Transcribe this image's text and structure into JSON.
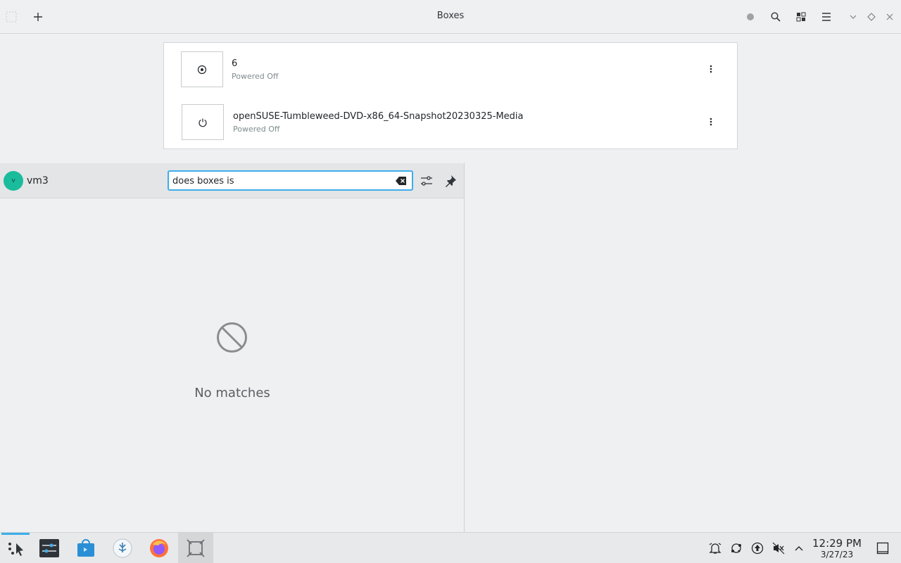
{
  "window": {
    "title": "Boxes"
  },
  "vms": [
    {
      "name": "6",
      "status": "Powered Off"
    },
    {
      "name": "openSUSE-Tumbleweed-DVD-x86_64-Snapshot20230325-Media",
      "status": "Powered Off"
    }
  ],
  "runner": {
    "avatar_letter": "v",
    "user": "vm3",
    "query": "does boxes is",
    "empty_message": "No matches"
  },
  "taskbar": {
    "time": "12:29 PM",
    "date": "3/27/23"
  },
  "colors": {
    "accent": "#3daee9",
    "avatar": "#1abc9c"
  }
}
